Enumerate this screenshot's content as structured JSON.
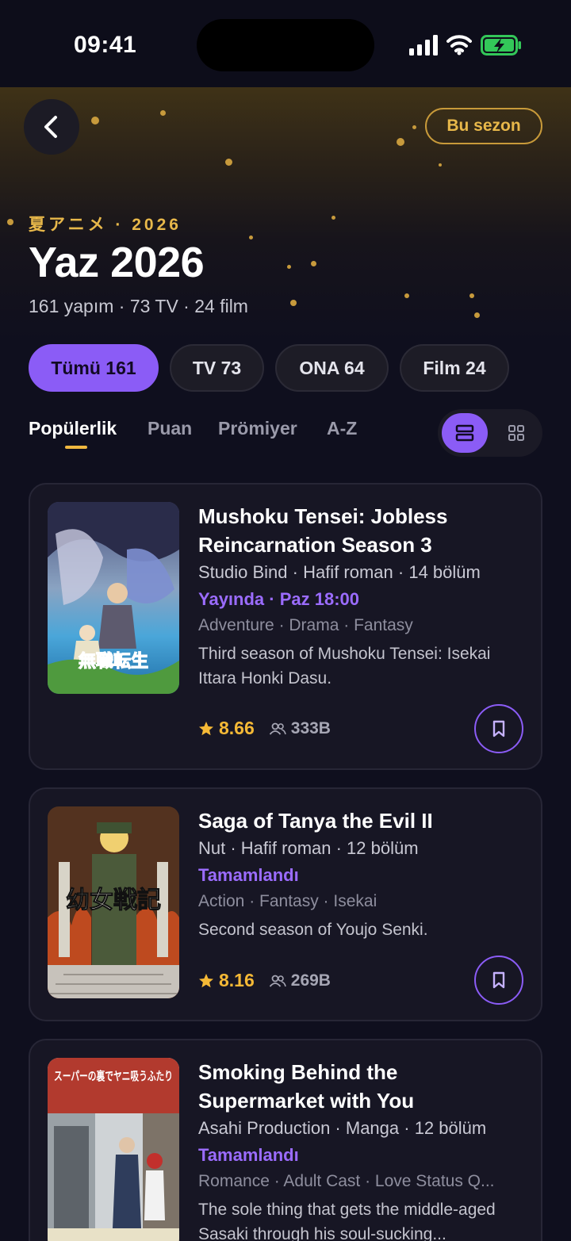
{
  "status": {
    "time": "09:41"
  },
  "header": {
    "season_button": "Bu sezon",
    "kicker": "夏アニメ · 2026",
    "title": "Yaz 2026",
    "subtitle": "161 yapım · 73 TV · 24 film"
  },
  "filters": [
    {
      "label": "Tümü 161",
      "active": true
    },
    {
      "label": "TV 73",
      "active": false
    },
    {
      "label": "ONA 64",
      "active": false
    },
    {
      "label": "Film 24",
      "active": false
    }
  ],
  "sort_tabs": [
    {
      "label": "Popülerlik",
      "active": true
    },
    {
      "label": "Puan",
      "active": false
    },
    {
      "label": "Prömiyer",
      "active": false
    },
    {
      "label": "A-Z",
      "active": false
    }
  ],
  "view_mode": "list",
  "colors": {
    "accent": "#8b5cf6",
    "gold": "#e8b84a",
    "background": "#0f0f1e",
    "card": "#171624"
  },
  "anime": [
    {
      "title": "Mushoku Tensei: Jobless Reincarnation Season 3",
      "meta": "Studio Bind · Hafif roman · 14 bölüm",
      "status": "Yayında · Paz 18:00",
      "genres": "Adventure · Drama · Fantasy",
      "description": "Third season of Mushoku Tensei: Isekai Ittara Honki Dasu.",
      "score": "8.66",
      "members": "333B",
      "poster_text": "無職転生"
    },
    {
      "title": "Saga of Tanya the Evil II",
      "meta": "Nut · Hafif roman · 12 bölüm",
      "status": "Tamamlandı",
      "genres": "Action · Fantasy · Isekai",
      "description": "Second season of Youjo Senki.",
      "score": "8.16",
      "members": "269B",
      "poster_text": "幼女戦記"
    },
    {
      "title": "Smoking Behind the Supermarket with You",
      "meta": "Asahi Production · Manga · 12 bölüm",
      "status": "Tamamlandı",
      "genres": "Romance · Adult Cast · Love Status Q...",
      "description": "The sole thing that gets the middle-aged Sasaki through his soul-sucking...",
      "poster_text": "スーパーの裏でヤニ吸うふたり"
    }
  ]
}
